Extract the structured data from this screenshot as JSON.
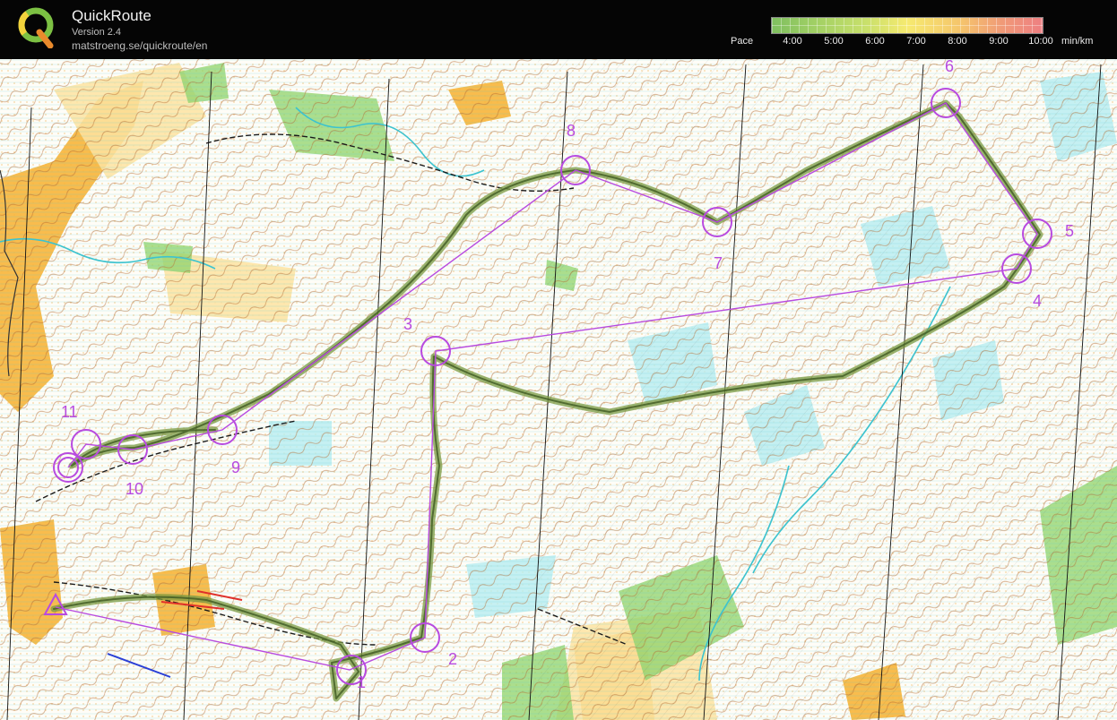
{
  "app": {
    "title": "QuickRoute",
    "version": "Version 2.4",
    "url": "matstroeng.se/quickroute/en"
  },
  "pace_scale": {
    "label": "Pace",
    "ticks": [
      "4:00",
      "5:00",
      "6:00",
      "7:00",
      "8:00",
      "9:00",
      "10:00"
    ],
    "unit": "min/km",
    "colors": [
      "#7fbf60",
      "#c9e06b",
      "#f6ea70",
      "#f5c46c",
      "#ee7f82"
    ]
  },
  "map": {
    "course_color": "#b84ae0",
    "route_color": "#6b8a3a",
    "control_labels": [
      "1",
      "2",
      "3",
      "4",
      "5",
      "6",
      "7",
      "8",
      "9",
      "10",
      "11"
    ]
  }
}
